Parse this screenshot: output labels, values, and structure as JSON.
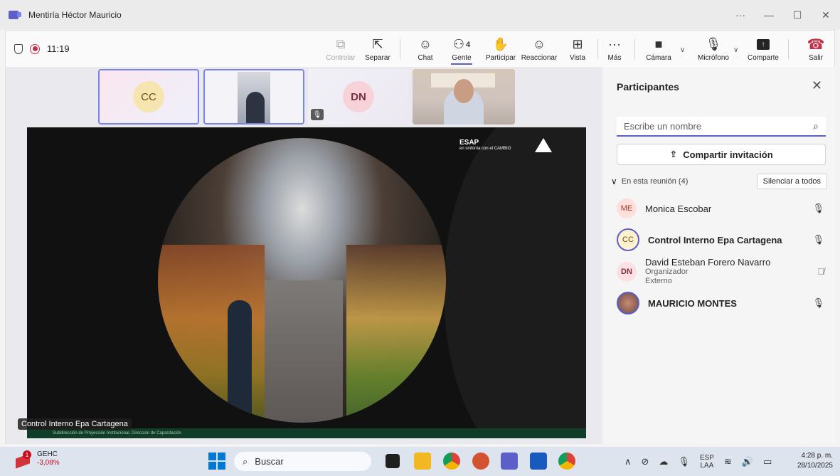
{
  "window": {
    "title": "Mentiría Héctor Mauricio",
    "controls": [
      "...",
      "—",
      "☐",
      "✕"
    ]
  },
  "meeting": {
    "timer": "11:19",
    "toolbar": {
      "controlar": "Controlar",
      "separar": "Separar",
      "chat": "Chat",
      "gente": "Gente",
      "gente_count": "4",
      "participar": "Participar",
      "reaccionar": "Reaccionar",
      "vista": "Vista",
      "mas": "Más",
      "camara": "Cámara",
      "microfono": "Micrófono",
      "comparte": "Comparte",
      "salir": "Salir"
    }
  },
  "stage": {
    "tiles": [
      {
        "initials": "CC"
      },
      {
        "initials": ""
      },
      {
        "initials": "DN"
      },
      {
        "initials": ""
      }
    ],
    "presenter_name": "Control Interno Epa Cartagena",
    "slide_footer": "Subdirección de Proyección Institucional, Dirección de Capacitación",
    "slide_logo_text": "ESAP",
    "slide_logo_sub": "en sinfonía con el CAMBIO"
  },
  "panel": {
    "title": "Participantes",
    "search_placeholder": "Escribe un nombre",
    "share_invite": "Compartir invitación",
    "section_label": "En esta reunión (4)",
    "mute_all": "Silenciar a todos",
    "participants": [
      {
        "initials": "ME",
        "name": "Monica Escobar",
        "role": "",
        "sub": ""
      },
      {
        "initials": "CC",
        "name": "Control Interno Epa Cartagena",
        "role": "",
        "sub": ""
      },
      {
        "initials": "DN",
        "name": "David Esteban Forero Navarro",
        "role": "Organizador",
        "sub": "Externo"
      },
      {
        "initials": "",
        "name": "MAURICIO MONTES",
        "role": "",
        "sub": ""
      }
    ]
  },
  "taskbar": {
    "stock_symbol": "GEHC",
    "stock_change": "-3,08%",
    "stock_badge": "1",
    "search_label": "Buscar",
    "lang_1": "ESP",
    "lang_2": "LAA",
    "time": "4:28 p. m.",
    "date": "28/10/2025"
  }
}
